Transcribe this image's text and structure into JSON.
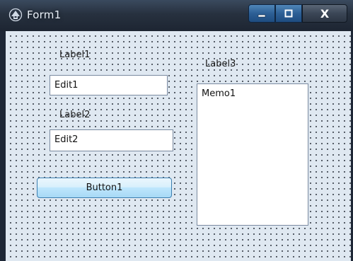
{
  "window": {
    "title": "Form1",
    "icon": "delphi-helmet-icon",
    "caption_buttons": {
      "minimize": "minimize-icon",
      "maximize": "maximize-icon",
      "close_label": "X"
    }
  },
  "form": {
    "label1": "Label1",
    "edit1": "Edit1",
    "label2": "Label2",
    "edit2": "Edit2",
    "button1": "Button1",
    "label3": "Label3",
    "memo1": "Memo1"
  },
  "colors": {
    "form_background": "#dfe8f1",
    "grid_dot": "#333a44",
    "titlebar": "#27313f",
    "button_accent": "#a7d9f5"
  }
}
